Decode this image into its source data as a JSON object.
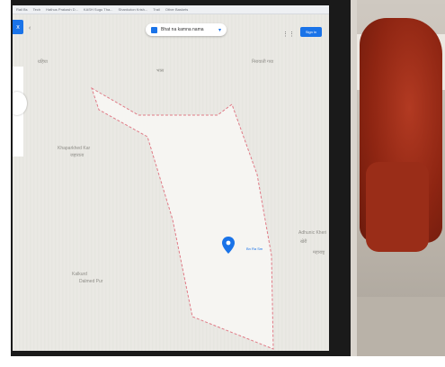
{
  "browser": {
    "tabs": [
      "Rail Bs",
      "Tech",
      "Hathus Prakash D...",
      "KASH Sugu Tha...",
      "Shankuton Krish...",
      "Trail",
      "Other Baskets"
    ]
  },
  "map": {
    "search_value": "Bhat na kamna nama",
    "search_icon": "pin-icon",
    "signin_label": "Sign in",
    "left_tab_label": "x",
    "place_labels": [
      "ग्रहिया",
      "निरावाती गया",
      "Khaparkhed Kar",
      "जहाराता",
      "Adhunic Kheri",
      "खेरी",
      "महाराष्ट्र",
      "Kalkurd",
      "Dalmed Pur",
      "भास"
    ],
    "pin_label": "Bn Ra Sm",
    "boundary_color": "#e07a86",
    "area_fill": "#f6f5f2",
    "pin_color": "#1a73e8"
  }
}
